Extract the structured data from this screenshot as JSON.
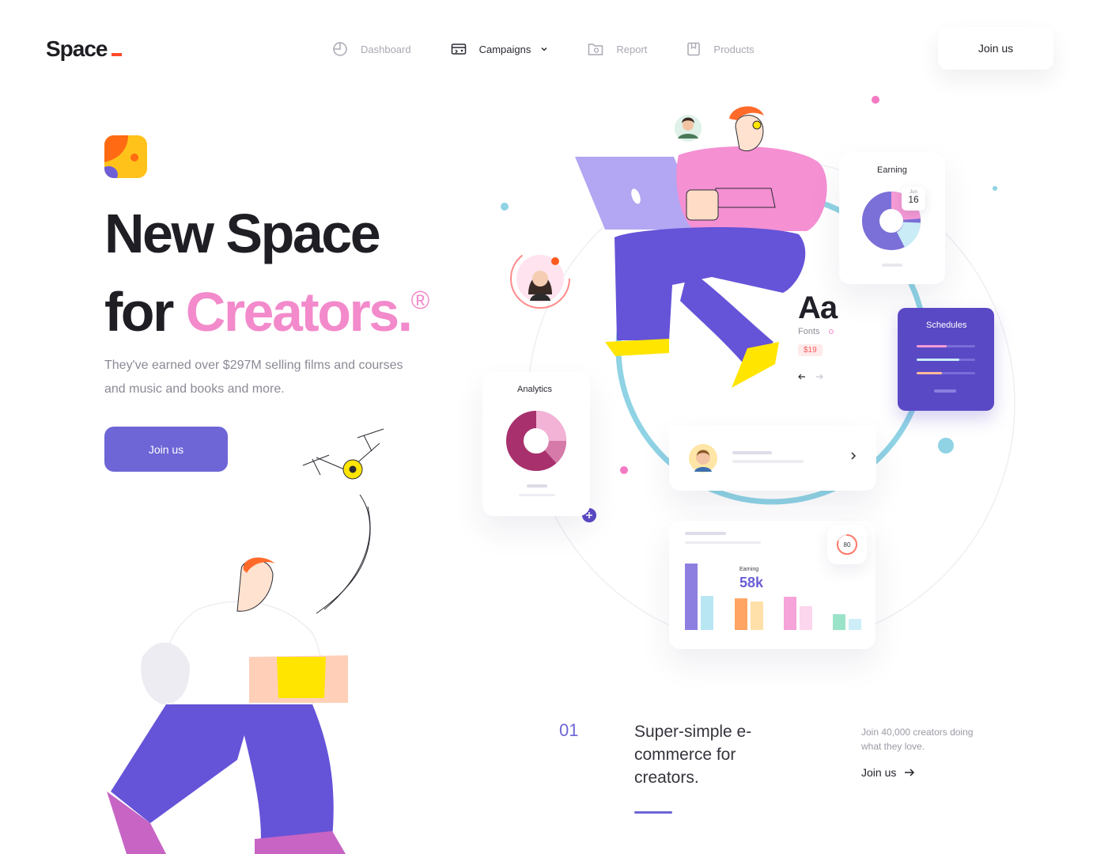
{
  "brand": {
    "name": "Space",
    "accent": "#ff4a2b"
  },
  "nav": {
    "items": [
      {
        "label": "Dashboard",
        "icon": "pie-chart-icon"
      },
      {
        "label": "Campaigns",
        "icon": "ticket-icon",
        "active": true,
        "dropdown": true
      },
      {
        "label": "Report",
        "icon": "folder-icon"
      },
      {
        "label": "Products",
        "icon": "bookmark-icon"
      }
    ],
    "join_label": "Join us"
  },
  "hero": {
    "title_line1": "New Space",
    "title_line2_prefix": "for ",
    "title_accent": "Creators.",
    "title_mark": "®",
    "subtitle": "They've earned over $297M selling films and courses and music and books and more.",
    "cta_label": "Join us"
  },
  "dashboard": {
    "earning_title": "Earning",
    "date_month": "Jun",
    "date_day": "16",
    "analytics_title": "Analytics",
    "schedules_title": "Schedules",
    "font_sample": "Aa",
    "fonts_label": "Fonts",
    "price": "$19",
    "bars_earning_label": "Earning",
    "bars_earning_value": "58k",
    "ring_value": "80",
    "ring_progress": 0.8
  },
  "feature": {
    "number": "01",
    "title": "Super-simple e-commerce for creators.",
    "subtitle": "Join 40,000 creators doing what they love.",
    "link_label": "Join us"
  },
  "colors": {
    "primary": "#6e66d6",
    "pink": "#f28acb",
    "schedule_bg": "#5a49c5",
    "teal": "#8fd3e4"
  }
}
